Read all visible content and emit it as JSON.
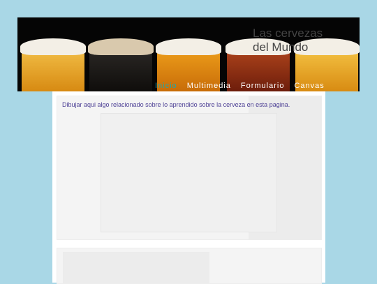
{
  "site": {
    "title": "Las cervezas del Mundo"
  },
  "nav": {
    "items": [
      {
        "label": "Inicio",
        "active": true
      },
      {
        "label": "Multimedia",
        "active": false
      },
      {
        "label": "Formulario",
        "active": false
      },
      {
        "label": "Canvas",
        "active": false
      }
    ]
  },
  "main": {
    "intro_text": "Dibujar aqui algo relacionado sobre lo aprendido sobre la cerveza en esta pagina."
  },
  "colors": {
    "page_background": "#a9d7e6",
    "active_nav": "#1aa9b1",
    "intro_text": "#4d4095"
  }
}
